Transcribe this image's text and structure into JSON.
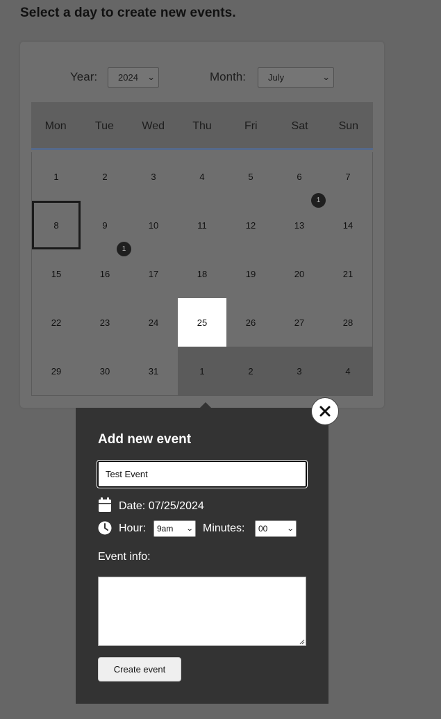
{
  "page": {
    "heading": "Select a day to create new events."
  },
  "calendar": {
    "year_label": "Year:",
    "year_value": "2024",
    "month_label": "Month:",
    "month_value": "July",
    "weekdays": [
      "Mon",
      "Tue",
      "Wed",
      "Thu",
      "Fri",
      "Sat",
      "Sun"
    ],
    "weeks": [
      [
        {
          "d": "1"
        },
        {
          "d": "2"
        },
        {
          "d": "3"
        },
        {
          "d": "4"
        },
        {
          "d": "5"
        },
        {
          "d": "6"
        },
        {
          "d": "7"
        }
      ],
      [
        {
          "d": "8",
          "today": true
        },
        {
          "d": "9"
        },
        {
          "d": "10"
        },
        {
          "d": "11"
        },
        {
          "d": "12"
        },
        {
          "d": "13",
          "events": "1"
        },
        {
          "d": "14"
        }
      ],
      [
        {
          "d": "15"
        },
        {
          "d": "16",
          "events": "1"
        },
        {
          "d": "17"
        },
        {
          "d": "18"
        },
        {
          "d": "19"
        },
        {
          "d": "20"
        },
        {
          "d": "21"
        }
      ],
      [
        {
          "d": "22"
        },
        {
          "d": "23"
        },
        {
          "d": "24"
        },
        {
          "d": "25",
          "selected": true
        },
        {
          "d": "26"
        },
        {
          "d": "27"
        },
        {
          "d": "28"
        }
      ],
      [
        {
          "d": "29"
        },
        {
          "d": "30"
        },
        {
          "d": "31"
        },
        {
          "d": "1",
          "other": true
        },
        {
          "d": "2",
          "other": true
        },
        {
          "d": "3",
          "other": true
        },
        {
          "d": "4",
          "other": true
        }
      ]
    ]
  },
  "popup": {
    "close_symbol": "✕",
    "title": "Add new event",
    "title_input_value": "Test Event",
    "date_text": "Date: 07/25/2024",
    "hour_label": "Hour:",
    "hour_value": "9am",
    "minutes_label": "Minutes:",
    "minutes_value": "00",
    "info_label": "Event info:",
    "info_value": "",
    "create_label": "Create event",
    "icons": [
      "calendar-icon",
      "clock-icon"
    ]
  },
  "colors": {
    "overlay": "#666666",
    "popup_bg": "#333333",
    "header_underline": "#56698a",
    "selected_day": "#ffffff"
  }
}
